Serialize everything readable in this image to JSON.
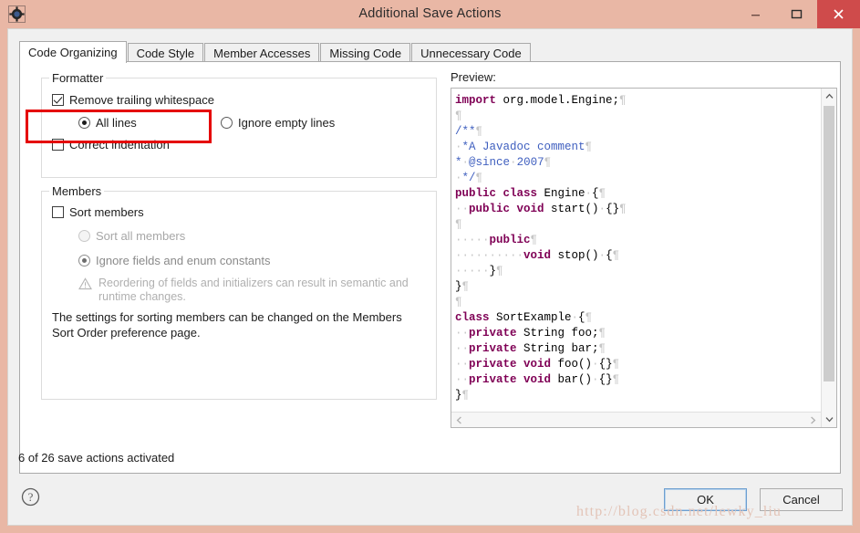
{
  "window": {
    "title": "Additional Save Actions",
    "icon": "gear-icon",
    "titlebar_color": "#e9b7a5",
    "close_color": "#cf4b4b",
    "buttons": {
      "minimize": "minimize-icon",
      "maximize": "maximize-icon",
      "close": "close-icon"
    }
  },
  "tabs": [
    {
      "label": "Code Organizing",
      "active": true
    },
    {
      "label": "Code Style",
      "active": false
    },
    {
      "label": "Member Accesses",
      "active": false
    },
    {
      "label": "Missing Code",
      "active": false
    },
    {
      "label": "Unnecessary Code",
      "active": false
    }
  ],
  "formatter": {
    "title": "Formatter",
    "remove_trailing_whitespace": {
      "label": "Remove trailing whitespace",
      "checked": true,
      "highlighted": true
    },
    "all_lines": {
      "label": "All lines",
      "selected": true
    },
    "ignore_empty_lines": {
      "label": "Ignore empty lines",
      "selected": false
    },
    "correct_indentation": {
      "label": "Correct indentation",
      "checked": false
    }
  },
  "members": {
    "title": "Members",
    "sort_members": {
      "label": "Sort members",
      "checked": false
    },
    "sort_all_members": {
      "label": "Sort all members",
      "selected": false,
      "disabled": true
    },
    "ignore_fields_and_enum_constants": {
      "label": "Ignore fields and enum constants",
      "selected": true,
      "disabled": true
    },
    "warning_icon": "warning-triangle-icon",
    "warning_text": "Reordering of fields and initializers can result in semantic and runtime changes.",
    "info_text": "The settings for sorting members can be changed on the Members Sort Order preference page."
  },
  "preview": {
    "label": "Preview:",
    "code_lines": [
      [
        {
          "t": "import",
          "c": "kw"
        },
        {
          "t": " org.model.Engine;",
          "c": ""
        },
        {
          "t": "¶",
          "c": "ws"
        }
      ],
      [
        {
          "t": "¶",
          "c": "ws"
        }
      ],
      [
        {
          "t": "/**",
          "c": "doc"
        },
        {
          "t": "¶",
          "c": "ws"
        }
      ],
      [
        {
          "t": "·",
          "c": "ws"
        },
        {
          "t": "*A Javadoc comment",
          "c": "doc"
        },
        {
          "t": "¶",
          "c": "ws"
        }
      ],
      [
        {
          "t": "*",
          "c": "doc"
        },
        {
          "t": "·",
          "c": "ws"
        },
        {
          "t": "@since",
          "c": "doc"
        },
        {
          "t": "·",
          "c": "ws"
        },
        {
          "t": "2007",
          "c": "doc"
        },
        {
          "t": "¶",
          "c": "ws"
        }
      ],
      [
        {
          "t": "·",
          "c": "ws"
        },
        {
          "t": "*/",
          "c": "doc"
        },
        {
          "t": "¶",
          "c": "ws"
        }
      ],
      [
        {
          "t": "public class",
          "c": "kw"
        },
        {
          "t": " Engine",
          "c": ""
        },
        {
          "t": "·",
          "c": "ws"
        },
        {
          "t": "{",
          "c": ""
        },
        {
          "t": "¶",
          "c": "ws"
        }
      ],
      [
        {
          "t": "··",
          "c": "ws"
        },
        {
          "t": "public void",
          "c": "kw"
        },
        {
          "t": " start()",
          "c": ""
        },
        {
          "t": "·",
          "c": "ws"
        },
        {
          "t": "{}",
          "c": ""
        },
        {
          "t": "¶",
          "c": "ws"
        }
      ],
      [
        {
          "t": "¶",
          "c": "ws"
        }
      ],
      [
        {
          "t": "·····",
          "c": "ws"
        },
        {
          "t": "public",
          "c": "kw"
        },
        {
          "t": "¶",
          "c": "ws"
        }
      ],
      [
        {
          "t": "··········",
          "c": "ws"
        },
        {
          "t": "void",
          "c": "kw"
        },
        {
          "t": " stop()",
          "c": ""
        },
        {
          "t": "·",
          "c": "ws"
        },
        {
          "t": "{",
          "c": ""
        },
        {
          "t": "¶",
          "c": "ws"
        }
      ],
      [
        {
          "t": "·····",
          "c": "ws"
        },
        {
          "t": "}",
          "c": ""
        },
        {
          "t": "¶",
          "c": "ws"
        }
      ],
      [
        {
          "t": "}",
          "c": ""
        },
        {
          "t": "¶",
          "c": "ws"
        }
      ],
      [
        {
          "t": "¶",
          "c": "ws"
        }
      ],
      [
        {
          "t": "class",
          "c": "kw"
        },
        {
          "t": " SortExample",
          "c": ""
        },
        {
          "t": "·",
          "c": "ws"
        },
        {
          "t": "{",
          "c": ""
        },
        {
          "t": "¶",
          "c": "ws"
        }
      ],
      [
        {
          "t": "··",
          "c": "ws"
        },
        {
          "t": "private",
          "c": "kw"
        },
        {
          "t": " String foo;",
          "c": ""
        },
        {
          "t": "¶",
          "c": "ws"
        }
      ],
      [
        {
          "t": "··",
          "c": "ws"
        },
        {
          "t": "private",
          "c": "kw"
        },
        {
          "t": " String bar;",
          "c": ""
        },
        {
          "t": "¶",
          "c": "ws"
        }
      ],
      [
        {
          "t": "··",
          "c": "ws"
        },
        {
          "t": "private void",
          "c": "kw"
        },
        {
          "t": " foo()",
          "c": ""
        },
        {
          "t": "·",
          "c": "ws"
        },
        {
          "t": "{}",
          "c": ""
        },
        {
          "t": "¶",
          "c": "ws"
        }
      ],
      [
        {
          "t": "··",
          "c": "ws"
        },
        {
          "t": "private void",
          "c": "kw"
        },
        {
          "t": " bar()",
          "c": ""
        },
        {
          "t": "·",
          "c": "ws"
        },
        {
          "t": "{}",
          "c": ""
        },
        {
          "t": "¶",
          "c": "ws"
        }
      ],
      [
        {
          "t": "}",
          "c": ""
        },
        {
          "t": "¶",
          "c": "ws"
        }
      ]
    ],
    "scrollbars": {
      "vertical": {
        "up": "scroll-up-icon",
        "down": "scroll-down-icon"
      },
      "horizontal": {
        "left": "scroll-left-icon",
        "right": "scroll-right-icon"
      }
    }
  },
  "footer": {
    "status": "6 of 26 save actions activated",
    "help_icon": "help-question-icon",
    "ok_label": "OK",
    "cancel_label": "Cancel"
  },
  "watermark": "http://blog.csdn.net/lewky_liu"
}
